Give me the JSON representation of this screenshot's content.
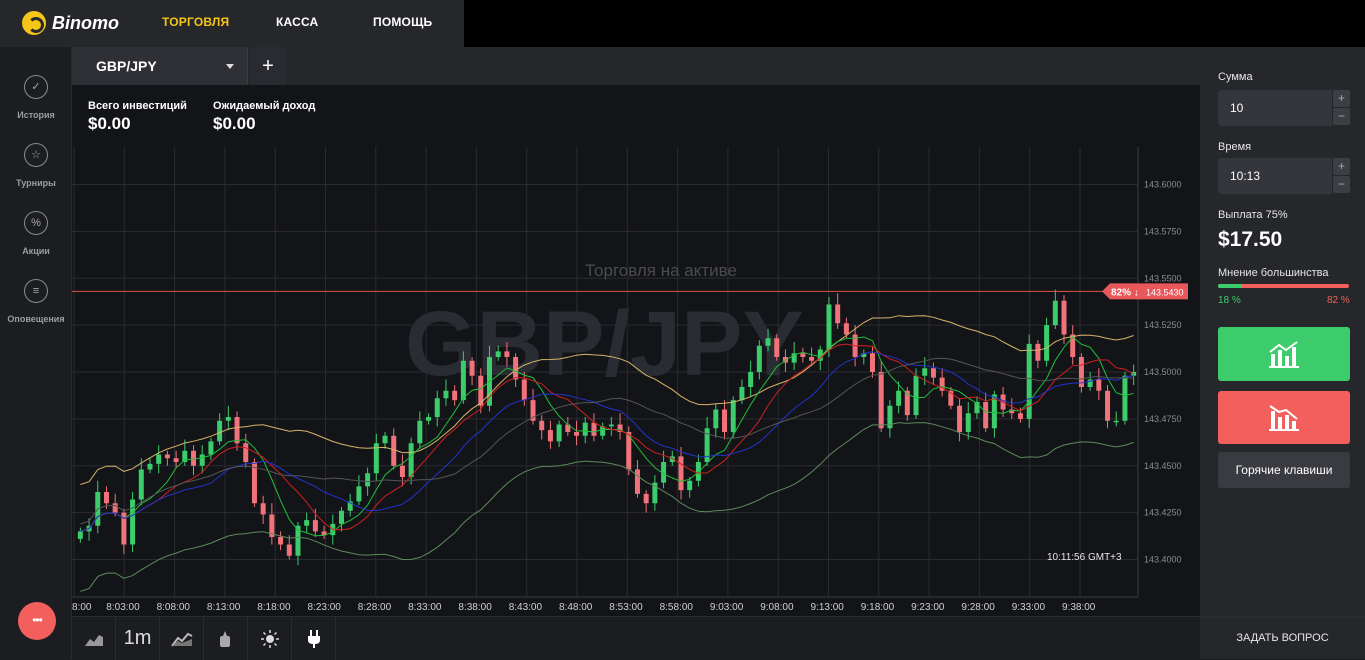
{
  "brand": {
    "name": "Binomo"
  },
  "nav": {
    "items": [
      {
        "label": "ТОРГОВЛЯ",
        "color": "#f5c518"
      },
      {
        "label": "КАССА",
        "color": "#ffffff"
      },
      {
        "label": "ПОМОЩЬ",
        "color": "#ffffff"
      }
    ]
  },
  "sidebar": {
    "items": [
      {
        "label": "История",
        "icon": "check-circle-icon"
      },
      {
        "label": "Турниры",
        "icon": "trophy-icon"
      },
      {
        "label": "Акции",
        "icon": "percent-icon"
      },
      {
        "label": "Оповещения",
        "icon": "bell-list-icon"
      }
    ]
  },
  "tabs": {
    "active": "GBP/JPY",
    "add": "+"
  },
  "investments": {
    "total_label": "Всего инвестиций",
    "total_value": "$0.00",
    "expected_label": "Ожидаемый доход",
    "expected_value": "$0.00"
  },
  "chart": {
    "watermark": "GBP/JPY",
    "notice": "Торговля на активе",
    "clock": "10:11:56 GMT+3",
    "current": {
      "percent": "82% ↓",
      "price": "143.5430",
      "value": 143.543
    },
    "ylim": [
      143.38,
      143.62
    ],
    "y_ticks": [
      143.6,
      143.575,
      143.55,
      143.525,
      143.5,
      143.475,
      143.45,
      143.425,
      143.4
    ],
    "y_tick_labels": [
      "143.6000",
      "143.5750",
      "143.5500",
      "143.5250",
      "143.5000",
      "143.4750",
      "143.4500",
      "143.4250",
      "143.4000"
    ],
    "x_tick_labels": [
      "8:00",
      "8:03:00",
      "8:08:00",
      "8:13:00",
      "8:18:00",
      "8:23:00",
      "8:28:00",
      "8:33:00",
      "8:38:00",
      "8:43:00",
      "8:48:00",
      "8:53:00",
      "8:58:00",
      "9:03:00",
      "9:08:00",
      "9:13:00",
      "9:18:00",
      "9:23:00",
      "9:28:00",
      "9:33:00",
      "9:38:00"
    ]
  },
  "chart_data": {
    "type": "candlestick",
    "closes": [
      143.415,
      143.418,
      143.436,
      143.43,
      143.425,
      143.408,
      143.432,
      143.448,
      143.451,
      143.456,
      143.454,
      143.452,
      143.458,
      143.45,
      143.456,
      143.463,
      143.474,
      143.476,
      143.462,
      143.452,
      143.43,
      143.424,
      143.412,
      143.408,
      143.402,
      143.418,
      143.421,
      143.415,
      143.413,
      143.419,
      143.426,
      143.431,
      143.439,
      143.446,
      143.462,
      143.466,
      143.45,
      143.444,
      143.462,
      143.474,
      143.476,
      143.486,
      143.49,
      143.485,
      143.506,
      143.498,
      143.482,
      143.508,
      143.511,
      143.508,
      143.496,
      143.485,
      143.474,
      143.469,
      143.463,
      143.472,
      143.468,
      143.466,
      143.473,
      143.466,
      143.471,
      143.472,
      143.468,
      143.448,
      143.435,
      143.43,
      143.441,
      143.452,
      143.455,
      143.437,
      143.442,
      143.452,
      143.47,
      143.48,
      143.468,
      143.485,
      143.492,
      143.5,
      143.514,
      143.518,
      143.508,
      143.505,
      143.51,
      143.508,
      143.506,
      143.512,
      143.536,
      143.526,
      143.52,
      143.508,
      143.51,
      143.5,
      143.47,
      143.482,
      143.49,
      143.477,
      143.498,
      143.502,
      143.497,
      143.49,
      143.482,
      143.468,
      143.478,
      143.484,
      143.47,
      143.488,
      143.48,
      143.478,
      143.475,
      143.515,
      143.506,
      143.525,
      143.538,
      143.52,
      143.508,
      143.492,
      143.496,
      143.49,
      143.474,
      143.474,
      143.498,
      143.5
    ],
    "series": [
      "price",
      "bollinger_upper",
      "bollinger_lower",
      "ma_fast",
      "ma_mid",
      "ma_slow"
    ]
  },
  "bottom_toolbar": [
    {
      "label": "",
      "icon": "area-chart-icon"
    },
    {
      "label": "1m",
      "icon": ""
    },
    {
      "label": "",
      "icon": "indicators-icon"
    },
    {
      "label": "",
      "icon": "drawing-tools-icon"
    },
    {
      "label": "",
      "icon": "theme-sun-icon"
    },
    {
      "label": "",
      "icon": "plug-icon"
    }
  ],
  "panel": {
    "amount_label": "Сумма",
    "amount_value": "10",
    "time_label": "Время",
    "time_value": "10:13",
    "payout_label": "Выплата 75%",
    "payout_value": "$17.50",
    "majority_label": "Мнение большинства",
    "majority_up": "18 %",
    "majority_down": "82 %",
    "majority_up_fraction": 0.18,
    "hotkeys": "Горячие клавиши",
    "ask": "ЗАДАТЬ ВОПРОС",
    "up_color": "#3ccc6c",
    "down_color": "#f25f5c"
  }
}
